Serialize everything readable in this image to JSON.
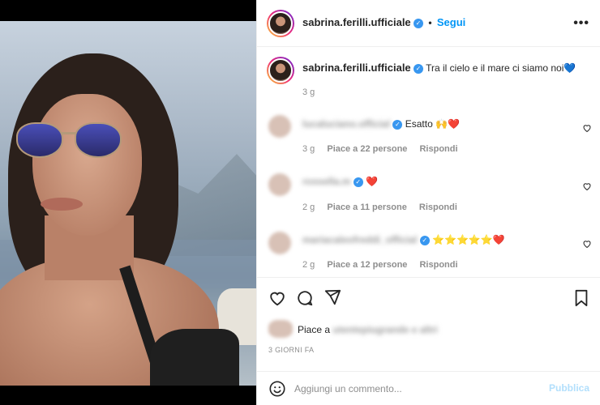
{
  "post": {
    "username": "sabrina.ferilli.ufficiale",
    "follow_label": "Segui",
    "more_icon": "more-options-icon",
    "caption": "Tra il cielo e il mare ci siamo noi",
    "caption_emoji": "💙",
    "caption_age": "3 g"
  },
  "comments": [
    {
      "username": "lucaluciano.official",
      "text": "Esatto 🙌❤️",
      "age": "3 g",
      "likes": "Piace a 22 persone",
      "reply": "Rispondi"
    },
    {
      "username": "rossella.m",
      "text": "❤️",
      "age": "2 g",
      "likes": "Piace a 11 persone",
      "reply": "Rispondi"
    },
    {
      "username": "mariacaleofreddi_official",
      "text": "⭐⭐⭐⭐⭐❤️",
      "age": "2 g",
      "likes": "Piace a 12 persone",
      "reply": "Rispondi"
    }
  ],
  "likes": {
    "prefix": "Piace a",
    "blurred": "utentepiugrande e altri"
  },
  "posted": "3 GIORNI FA",
  "add_comment": {
    "placeholder": "Aggiungi un commento...",
    "publish": "Pubblica"
  },
  "colors": {
    "accent": "#0095f6",
    "verified": "#3897f0",
    "heart": "#ed4956"
  }
}
